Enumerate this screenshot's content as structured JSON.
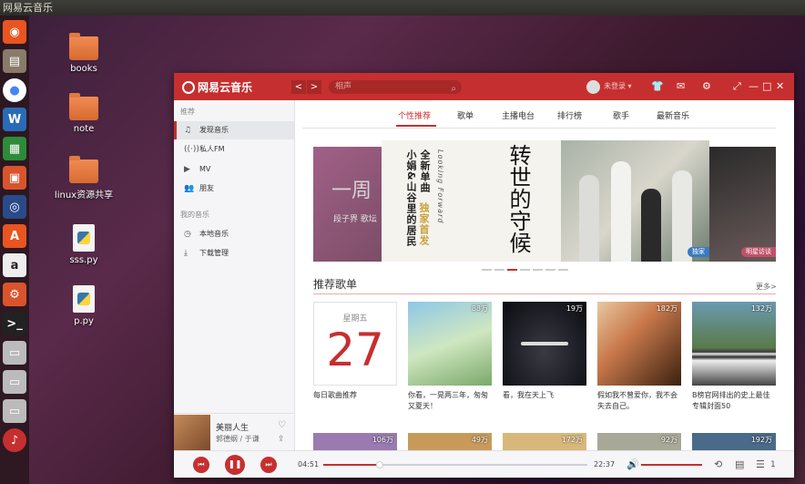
{
  "topbar": {
    "title": "网易云音乐"
  },
  "launcher": {
    "items": [
      "ubuntu-icon",
      "files-icon",
      "chrome-icon",
      "writer-icon",
      "calc-icon",
      "impress-icon",
      "network-icon",
      "software-icon",
      "amazon-icon",
      "settings-icon",
      "terminal-icon",
      "drive-icon",
      "drive-icon",
      "drive-icon",
      "netease-music-icon"
    ]
  },
  "desktop": {
    "icons": [
      {
        "label": "books",
        "type": "folder"
      },
      {
        "label": "note",
        "type": "folder"
      },
      {
        "label": "linux资源共享",
        "type": "folder"
      },
      {
        "label": "sss.py",
        "type": "python"
      },
      {
        "label": "p.py",
        "type": "python"
      }
    ]
  },
  "app": {
    "logo": "网易云音乐",
    "search": {
      "placeholder": "相声"
    },
    "login": "未登录 ▾",
    "sidebar": {
      "recommend_header": "推荐",
      "my_music_header": "我的音乐",
      "items": [
        {
          "label": "发现音乐",
          "icon": "music-note-icon",
          "active": true
        },
        {
          "label": "私人FM",
          "icon": "radio-icon"
        },
        {
          "label": "MV",
          "icon": "video-icon"
        },
        {
          "label": "朋友",
          "icon": "friends-icon"
        }
      ],
      "my_items": [
        {
          "label": "本地音乐",
          "icon": "local-music-icon"
        },
        {
          "label": "下载管理",
          "icon": "download-icon"
        }
      ]
    },
    "mini_player": {
      "title": "美丽人生",
      "artist": "郭德纲 / 于谦"
    },
    "tabs": [
      "个性推荐",
      "歌单",
      "主播电台",
      "排行榜",
      "歌手",
      "最新音乐"
    ],
    "banner": {
      "left_text": "一周",
      "left_subtext": "段子界 歌坛",
      "col1": "小娟&山谷里的居民",
      "col2": "全新单曲",
      "col3": "独家首发",
      "col4": "Looking Forward",
      "calligraphy": "转世的守候",
      "tag_main": "独家",
      "tag_right": "明星访谈"
    },
    "section": {
      "title": "推荐歌单",
      "more": "更多>"
    },
    "cards": [
      {
        "label": "每日歌曲推荐",
        "type": "calendar",
        "weekday": "星期五",
        "day": "27"
      },
      {
        "label": "你看，一晃两三年，匆匆又夏天！",
        "count": "88万"
      },
      {
        "label": "看，我在天上飞",
        "count": "19万"
      },
      {
        "label": "假如我不曾爱你，我不会失去自己。",
        "count": "182万"
      },
      {
        "label": "B榜官网排出的史上最佳专辑封面50",
        "count": "132万"
      }
    ],
    "row2_counts": [
      "106万",
      "49万",
      "172万",
      "92万",
      "192万"
    ],
    "player": {
      "current": "04:51",
      "total": "22:37",
      "progress": 0.215,
      "volume": 1.0,
      "playlist_count": "1"
    }
  }
}
